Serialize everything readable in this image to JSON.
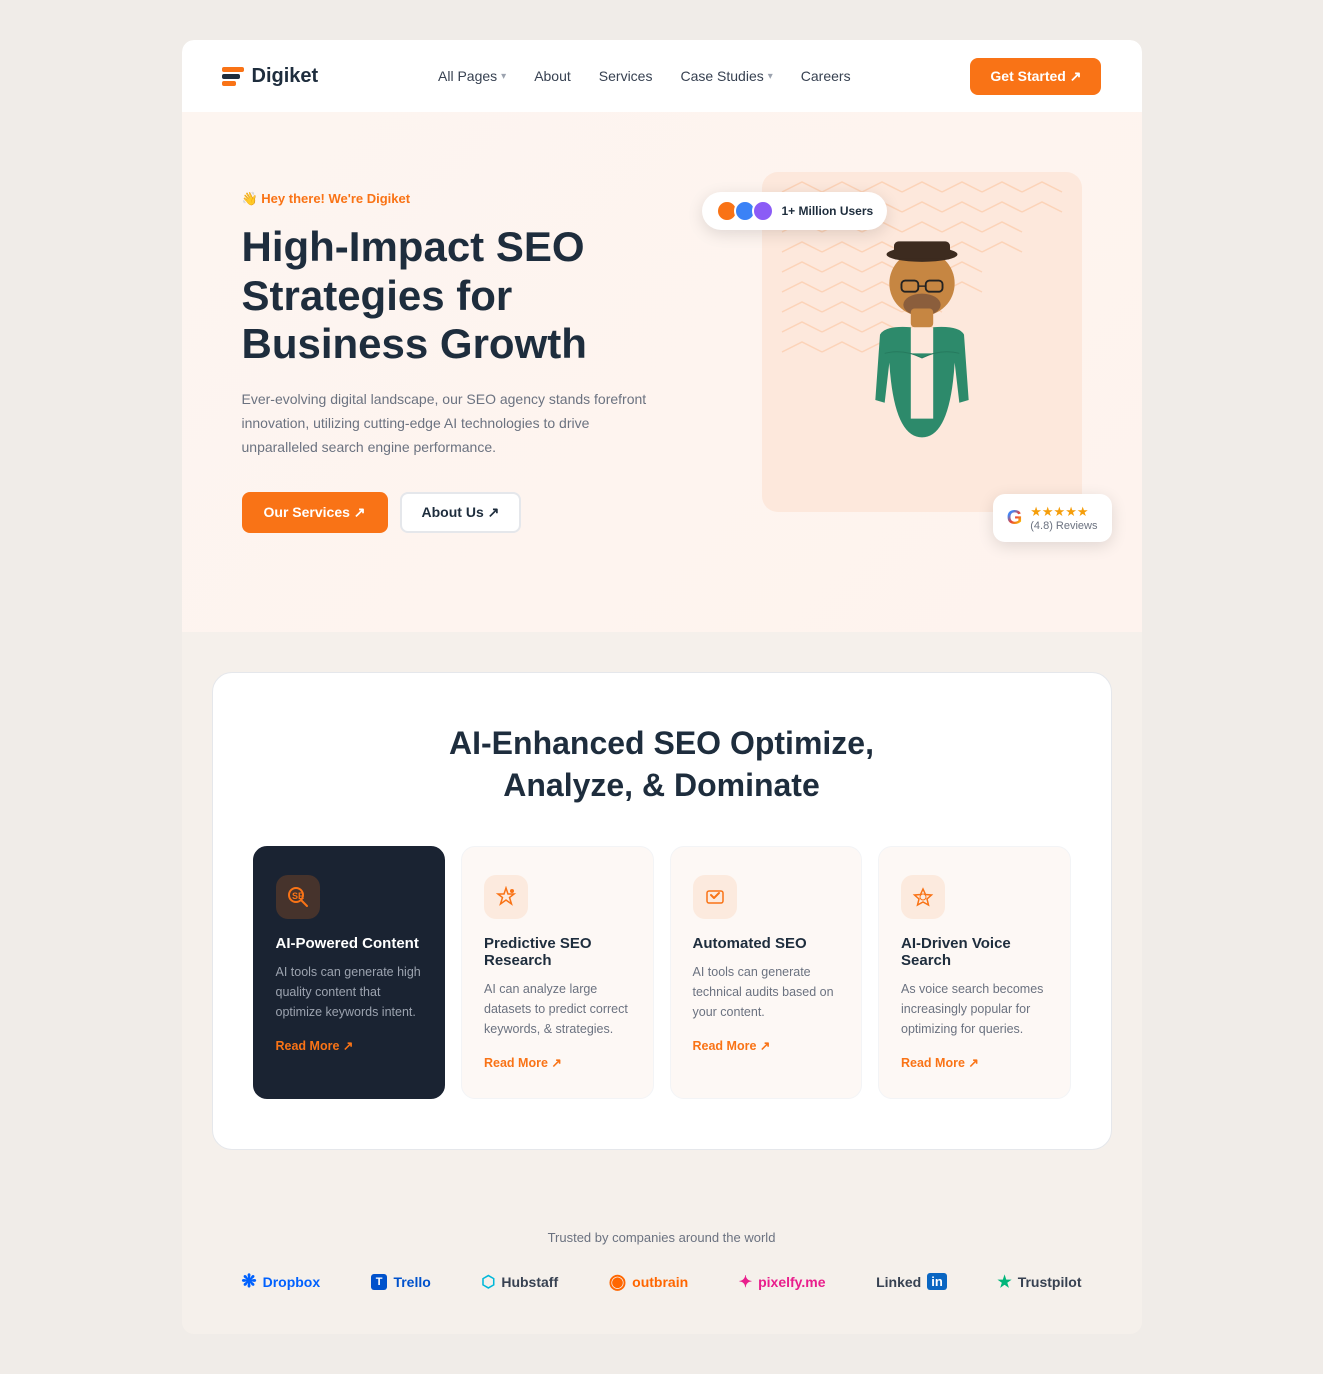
{
  "brand": {
    "name": "Digiket"
  },
  "navbar": {
    "links": [
      {
        "label": "All Pages",
        "hasDropdown": true
      },
      {
        "label": "About",
        "hasDropdown": false
      },
      {
        "label": "Services",
        "hasDropdown": false
      },
      {
        "label": "Case Studies",
        "hasDropdown": true
      },
      {
        "label": "Careers",
        "hasDropdown": false
      }
    ],
    "cta_label": "Get Started ↗"
  },
  "hero": {
    "badge": "👋 Hey there! We're Digiket",
    "title": "High-Impact SEO Strategies for Business Growth",
    "description": "Ever-evolving digital landscape, our SEO agency stands forefront innovation, utilizing cutting-edge AI technologies to drive unparalleled search engine performance.",
    "btn_primary": "Our Services ↗",
    "btn_secondary": "About Us ↗",
    "users_badge": "1+ Million Users",
    "google_rating": "4.8",
    "google_reviews": "(4.8) Reviews"
  },
  "services": {
    "title": "AI-Enhanced SEO Optimize,\nAnalyze, & Dominate",
    "cards": [
      {
        "name": "AI-Powered Content",
        "icon": "🔍",
        "desc": "AI tools can generate high quality content that optimize keywords intent.",
        "read_more": "Read More ↗",
        "dark": true
      },
      {
        "name": "Predictive SEO Research",
        "icon": "🚀",
        "desc": "AI can analyze large datasets to predict correct keywords, & strategies.",
        "read_more": "Read More ↗",
        "dark": false
      },
      {
        "name": "Automated SEO",
        "icon": "⚡",
        "desc": "AI tools can generate technical audits based on your content.",
        "read_more": "Read More ↗",
        "dark": false
      },
      {
        "name": "AI-Driven Voice Search",
        "icon": "🎤",
        "desc": "As voice search becomes increasingly popular for optimizing for queries.",
        "read_more": "Read More ↗",
        "dark": false
      }
    ]
  },
  "trusted": {
    "label": "Trusted by companies around the world",
    "logos": [
      {
        "name": "Dropbox",
        "color": "#0061fe",
        "icon": "💧"
      },
      {
        "name": "Trello",
        "color": "#0052cc",
        "icon": "📋"
      },
      {
        "name": "Hubstaff",
        "color": "#00b8d9",
        "icon": "⏱"
      },
      {
        "name": "Outbrain",
        "color": "#ff6600",
        "icon": "●"
      },
      {
        "name": "pixelfy.me",
        "color": "#e91e8c",
        "icon": "✦"
      },
      {
        "name": "LinkedIn",
        "color": "#0a66c2",
        "icon": "in"
      },
      {
        "name": "Trustpilot",
        "color": "#00b67a",
        "icon": "★"
      }
    ]
  }
}
